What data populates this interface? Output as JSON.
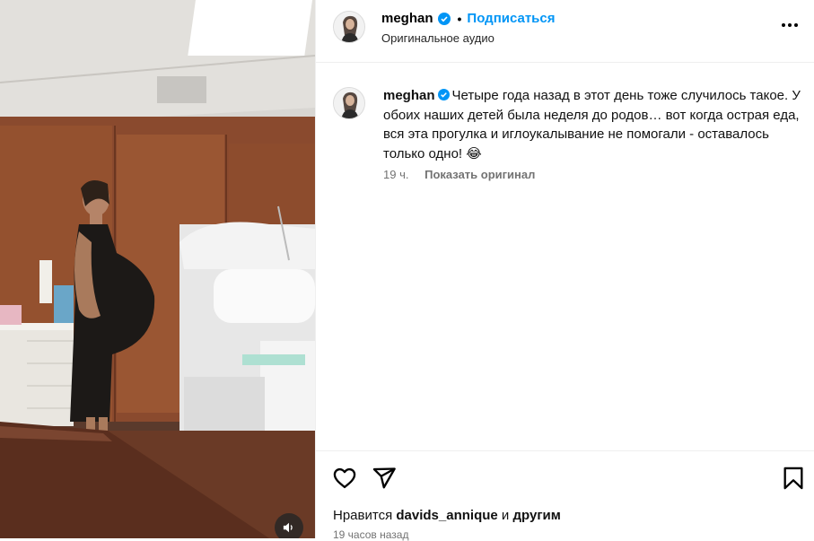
{
  "header": {
    "username": "meghan",
    "separator": "•",
    "follow_label": "Подписаться",
    "audio_label": "Оригинальное аудио"
  },
  "caption": {
    "username": "meghan",
    "text": "Четыре года назад в этот день тоже случилось такое. У обоих наших детей была неделя до родов… вот когда острая еда, вся эта прогулка и иглоукалывание не помогали - оставалось только одно! 😂",
    "time": "19 ч.",
    "show_original": "Показать оригинал"
  },
  "likes": {
    "prefix": "Нравится",
    "user": "davids_annique",
    "middle": "и",
    "others": "другим"
  },
  "posted_ago": "19 часов назад",
  "colors": {
    "accent": "#0095f6",
    "verified": "#0095f6",
    "muted_text": "#737373"
  },
  "icons": [
    "verified-badge-icon",
    "more-options-icon",
    "heart-icon",
    "share-icon",
    "bookmark-icon",
    "speaker-icon"
  ]
}
